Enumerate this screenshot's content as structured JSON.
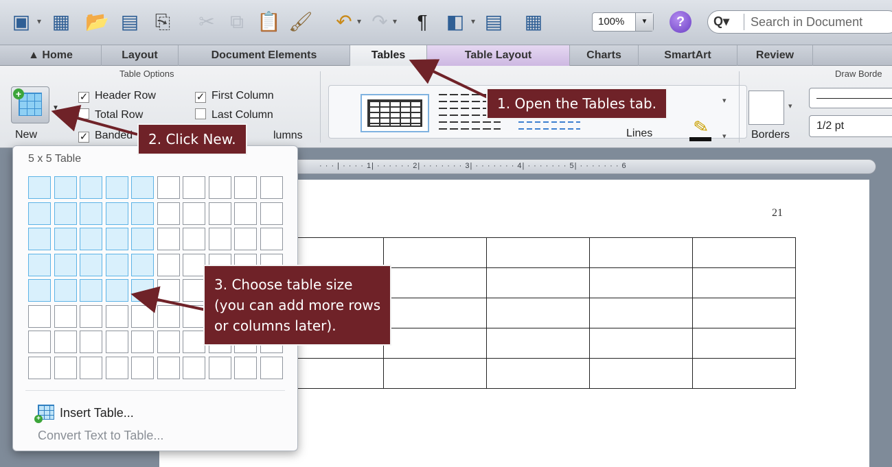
{
  "toolbar": {
    "zoom_value": "100%",
    "search_placeholder": "Search in Document",
    "icons": [
      "new-doc-icon",
      "templates-icon",
      "open-icon",
      "save-icon",
      "print-icon",
      "cut-icon",
      "copy-icon",
      "paste-icon",
      "format-painter-icon",
      "undo-icon",
      "redo-icon",
      "pilcrow-icon",
      "sidebar-icon",
      "gallery-icon",
      "media-browser-icon",
      "zoom-icon",
      "help-icon",
      "search-icon"
    ]
  },
  "tabs": {
    "home": "Home",
    "layout": "Layout",
    "document_elements": "Document Elements",
    "tables": "Tables",
    "table_layout": "Table Layout",
    "charts": "Charts",
    "smartart": "SmartArt",
    "review": "Review"
  },
  "ribbon": {
    "table_options_title": "Table Options",
    "new_label": "New",
    "header_row": "Header Row",
    "total_row": "Total Row",
    "banded_rows": "Banded",
    "first_column": "First Column",
    "last_column": "Last Column",
    "banded_columns": "lumns",
    "lines_label": "Lines",
    "borders_label": "Borders",
    "draw_borders_title": "Draw Borde",
    "line_weight": "1/2 pt",
    "checked": {
      "header_row": true,
      "total_row": false,
      "banded_rows": true,
      "first_column": true,
      "last_column": false
    }
  },
  "ruler": {
    "text": "· · · | · · · · 1|  · · · · · · 2| · · · · · · · 3| · · · · · · · 4| · · · · · · · 5| · · · · · · · 6"
  },
  "document": {
    "page_number": "21",
    "table": {
      "rows": 5,
      "cols": 5
    }
  },
  "dropdown": {
    "size_label": "5 x 5 Table",
    "grid": {
      "rows": 8,
      "cols": 10,
      "selected_rows": 5,
      "selected_cols": 5
    },
    "insert_table": "Insert Table...",
    "convert_text": "Convert Text to Table..."
  },
  "callouts": {
    "step1": "1. Open the Tables tab.",
    "step2": "2. Click New.",
    "step3_line1": "3. Choose table size",
    "step3_line2": "(you can add more rows",
    "step3_line3": "or columns later)."
  },
  "colors": {
    "callout_bg": "#6f2228",
    "grid_selected": "#d9f0fc",
    "grid_selected_border": "#5cb3e6"
  }
}
